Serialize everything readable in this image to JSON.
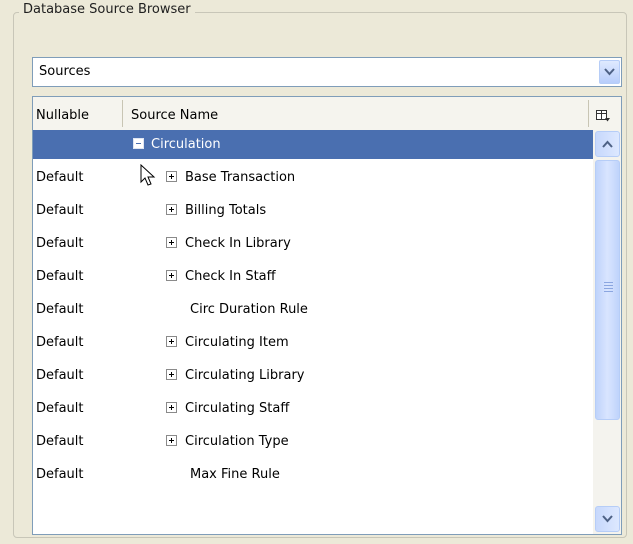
{
  "groupbox": {
    "title": "Database Source Browser"
  },
  "combo": {
    "value": "Sources"
  },
  "table": {
    "columns": [
      "Nullable",
      "Source Name"
    ],
    "rows": [
      {
        "nullable": "",
        "name": "Circulation",
        "expander": "minus",
        "selected": true
      },
      {
        "nullable": "Default",
        "name": "Base Transaction",
        "expander": "plus"
      },
      {
        "nullable": "Default",
        "name": "Billing Totals",
        "expander": "plus"
      },
      {
        "nullable": "Default",
        "name": "Check In Library",
        "expander": "plus"
      },
      {
        "nullable": "Default",
        "name": "Check In Staff",
        "expander": "plus"
      },
      {
        "nullable": "Default",
        "name": "Circ Duration Rule",
        "expander": "none"
      },
      {
        "nullable": "Default",
        "name": "Circulating Item",
        "expander": "plus"
      },
      {
        "nullable": "Default",
        "name": "Circulating Library",
        "expander": "plus"
      },
      {
        "nullable": "Default",
        "name": "Circulating Staff",
        "expander": "plus"
      },
      {
        "nullable": "Default",
        "name": "Circulation Type",
        "expander": "plus"
      },
      {
        "nullable": "Default",
        "name": "Max Fine Rule",
        "expander": "none"
      }
    ]
  },
  "colors": {
    "selection": "#4a6fb0",
    "accent_border": "#7f9db9"
  }
}
